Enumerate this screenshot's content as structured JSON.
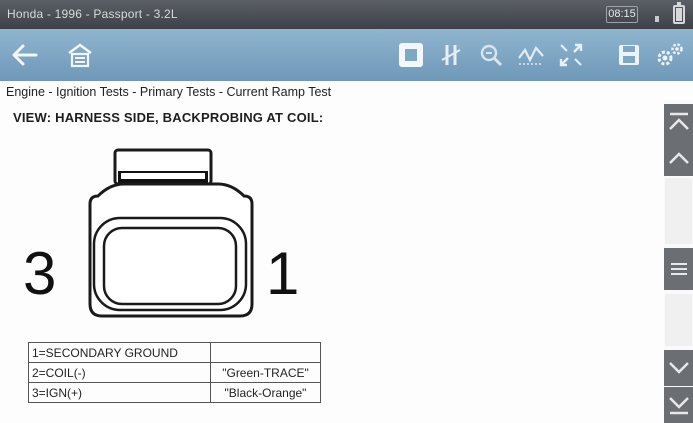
{
  "titlebar": {
    "title": "Honda - 1996 - Passport - 3.2L",
    "clock": "08:15"
  },
  "toolbar": {
    "buttons": [
      {
        "icon": "back-arrow-icon"
      },
      {
        "icon": "home-icon"
      },
      {
        "icon": "stop-icon"
      },
      {
        "icon": "pause-icon"
      },
      {
        "icon": "zoom-icon"
      },
      {
        "icon": "scope-icon"
      },
      {
        "icon": "expand-icon"
      },
      {
        "icon": "save-icon"
      },
      {
        "icon": "settings-icon"
      }
    ]
  },
  "breadcrumb": "Engine - Ignition Tests - Primary Tests - Current Ramp Test",
  "view_title": "VIEW: HARNESS SIDE, BACKPROBING AT COIL:",
  "connector": {
    "left_pin": "3",
    "right_pin": "1"
  },
  "pin_table": [
    {
      "pin": "1=SECONDARY GROUND",
      "wire": ""
    },
    {
      "pin": "2=COIL(-)",
      "wire": "\"Green-TRACE\""
    },
    {
      "pin": "3=IGN(+)",
      "wire": "\"Black-Orange\""
    }
  ],
  "colors": {
    "titlebar": "#4a4d53",
    "toolbar": "#7ea7c4",
    "scroll_button": "#6b6e72"
  }
}
